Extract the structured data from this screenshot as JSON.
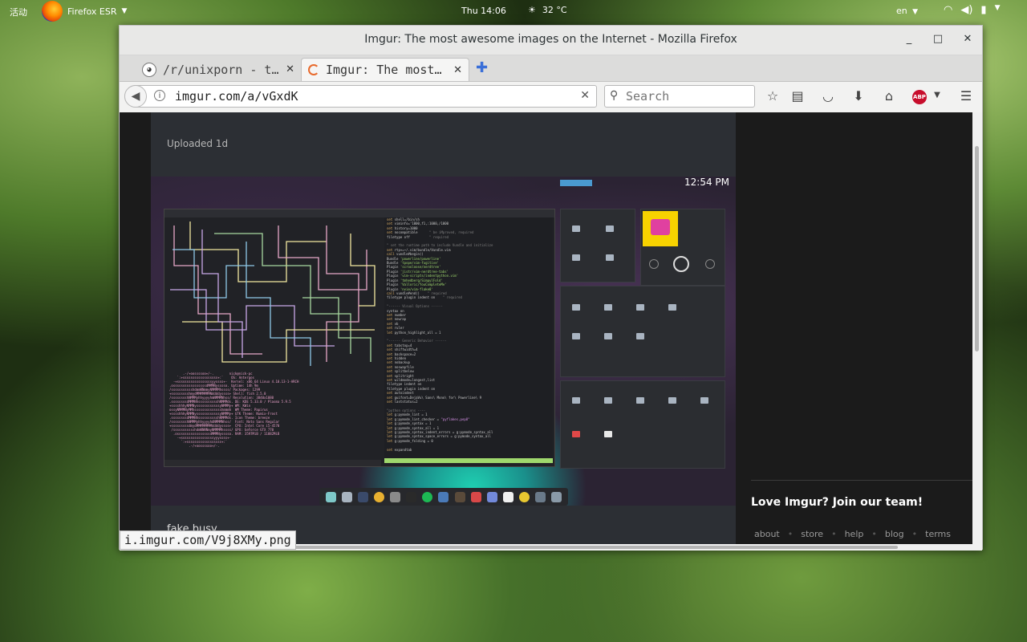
{
  "top_panel": {
    "activities": "活动",
    "app_name": "Firefox ESR",
    "clock": "Thu 14:06",
    "temperature": "32 °C",
    "language": "en"
  },
  "window": {
    "title": "Imgur: The most awesome images on the Internet - Mozilla Firefox"
  },
  "tabs": [
    {
      "label": "/r/unixporn - t…"
    },
    {
      "label": "Imgur: The most…"
    }
  ],
  "navbar": {
    "url": "imgur.com/a/vGxdK",
    "search_placeholder": "Search"
  },
  "post": {
    "uploaded": "Uploaded 1d",
    "caption": "fake busy",
    "screenshot_clock": "12:54 PM"
  },
  "sidebar": {
    "promo": "Love Imgur? Join our team!",
    "footer_links": [
      "about",
      "store",
      "help",
      "blog",
      "terms"
    ]
  },
  "status_url": "i.imgur.com/V9j8XMy.png"
}
